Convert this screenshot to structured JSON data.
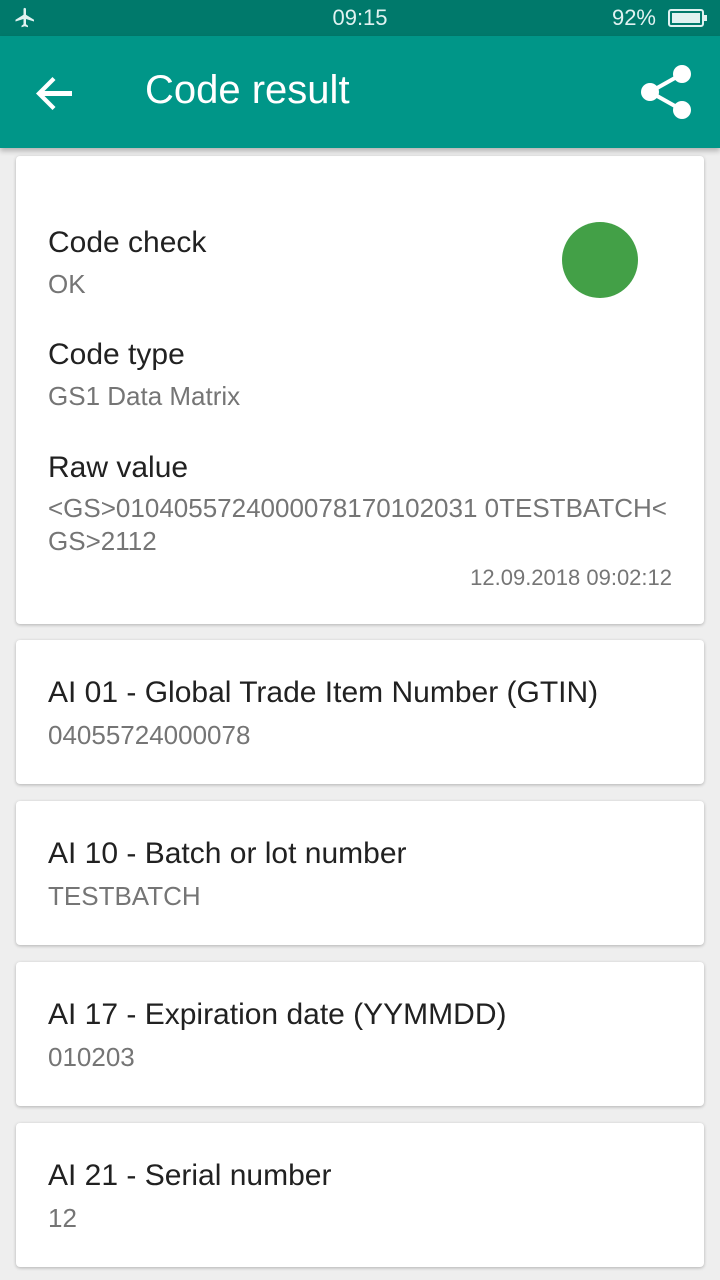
{
  "status_bar": {
    "time": "09:15",
    "battery_percent": "92%",
    "airplane_icon": "airplane-icon",
    "battery_icon": "battery-icon"
  },
  "app_bar": {
    "title": "Code result",
    "back_icon": "back-arrow-icon",
    "share_icon": "share-icon",
    "color": "#009688"
  },
  "summary": {
    "code_check_label": "Code check",
    "code_check_value": "OK",
    "status_color": "#43a047",
    "code_type_label": "Code type",
    "code_type_value": "GS1 Data Matrix",
    "raw_value_label": "Raw value",
    "raw_value": "<GS>0104055724000078170102031 0TESTBATCH<GS>2112",
    "timestamp": "12.09.2018 09:02:12"
  },
  "ai_items": [
    {
      "label": "AI 01 - Global Trade Item Number (GTIN)",
      "value": "04055724000078"
    },
    {
      "label": "AI 10 - Batch or lot number",
      "value": "TESTBATCH"
    },
    {
      "label": "AI 17 - Expiration date (YYMMDD)",
      "value": "010203"
    },
    {
      "label": "AI 21 - Serial number",
      "value": "12"
    }
  ]
}
